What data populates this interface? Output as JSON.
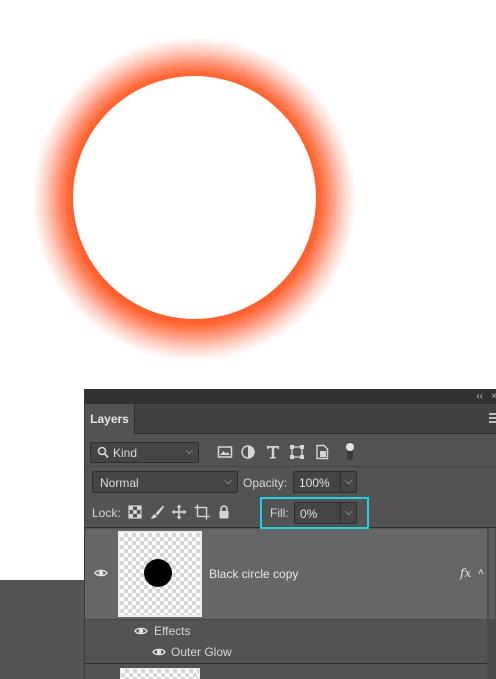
{
  "panel": {
    "tab_label": "Layers",
    "collapse_glyph": "‹‹",
    "close_glyph": "×"
  },
  "filter": {
    "kind_label": "Kind",
    "chevron": "⌵",
    "icons": [
      "image-filter-icon",
      "adjustment-filter-icon",
      "type-filter-icon",
      "shape-filter-icon",
      "smart-object-filter-icon",
      "filter-toggle-icon"
    ]
  },
  "blend": {
    "mode": "Normal",
    "opacity_label": "Opacity:",
    "opacity_value": "100%"
  },
  "lock": {
    "label": "Lock:",
    "icons": [
      "lock-transparent-pixels-icon",
      "lock-image-pixels-icon",
      "lock-position-icon",
      "lock-artboard-icon",
      "lock-all-icon"
    ],
    "fill_label": "Fill:",
    "fill_value": "0%",
    "highlight_color": "#1ed3e6"
  },
  "layers": {
    "selected": {
      "name": "Black circle copy",
      "fx_label": "fx",
      "expand_glyph": "˄"
    },
    "effects_label": "Effects",
    "outer_glow_label": "Outer Glow"
  },
  "canvas": {
    "glow_color": "#ff5a2a",
    "background": "#ffffff"
  }
}
